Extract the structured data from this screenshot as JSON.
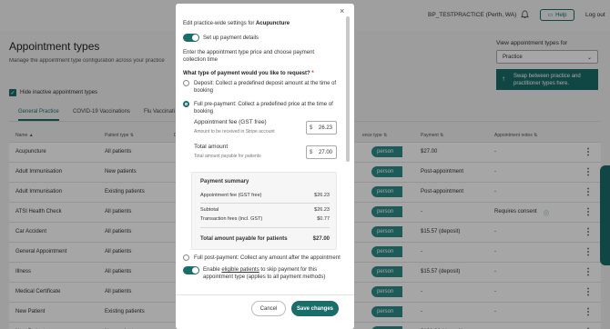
{
  "header": {
    "practice": "BP_TESTPRACTICE (Perth, WA)",
    "help_label": "Help",
    "logout_label": "Log out"
  },
  "page": {
    "title": "Appointment types",
    "subtitle": "Manage the appointment type configuration across your practice",
    "view_label": "View appointment types for",
    "view_value": "Practice",
    "swap_label": "Swap between practice and practitioner types here.",
    "hide_inactive_label": "Hide inactive appointment types"
  },
  "tabs": [
    "General Practice",
    "COVID-19 Vaccinations",
    "Flu Vaccinati"
  ],
  "table": {
    "headers": {
      "name": "Name",
      "patient_type": "Patient type",
      "d": "D",
      "attendance": "ence type",
      "payment": "Payment",
      "notes": "Appointment notes"
    },
    "rows": [
      {
        "name": "Acupuncture",
        "patient": "All patients",
        "att": "person",
        "payment": "$27.00",
        "notes": "-"
      },
      {
        "name": "Adult Immunisation",
        "patient": "New patients",
        "att": "person",
        "payment": "Post-appointment",
        "notes": "-"
      },
      {
        "name": "Adult Immunisation",
        "patient": "Existing patients",
        "att": "person",
        "payment": "Post-appointment",
        "notes": "-"
      },
      {
        "name": "ATSI Health Check",
        "patient": "All patients",
        "att": "person",
        "payment": "-",
        "notes": "Requires consent"
      },
      {
        "name": "Car Accident",
        "patient": "All patients",
        "att": "person",
        "payment": "$15.57 (deposit)",
        "notes": "-"
      },
      {
        "name": "General Appointment",
        "patient": "All patients",
        "att": "person",
        "payment": "-",
        "notes": "-"
      },
      {
        "name": "Illness",
        "patient": "All patients",
        "att": "person",
        "payment": "$15.57 (deposit)",
        "notes": "-"
      },
      {
        "name": "Medical Certificate",
        "patient": "All patients",
        "att": "person",
        "payment": "-",
        "notes": "-"
      },
      {
        "name": "New Patient",
        "patient": "Existing patients",
        "att": "person",
        "payment": "-",
        "notes": "-"
      },
      {
        "name": "New Patient",
        "patient": "New patients",
        "att": "person",
        "payment": "$101.06 (deposit)",
        "notes": "-"
      }
    ]
  },
  "side_tab_label": "Stripe Pay Guide",
  "modal": {
    "intro_prefix": "Edit practice-wide settings for ",
    "intro_name": "Acupuncture",
    "setup_label": "Set up payment details",
    "instructions": "Enter the appointment type price and choose payment collection time",
    "question": "What type of payment would you like to request?",
    "required_mark": "*",
    "option_deposit": "Deposit: Collect a predefined deposit amount at the time of booking",
    "option_full": "Full pre-payment: Collect a predefined price at the time of booking",
    "fee_label": "Appointment fee (GST free)",
    "fee_help": "Amount to be received in Stripe account",
    "fee_value": "26.23",
    "total_label": "Total amount",
    "total_help": "Total amount payable for patients",
    "total_value": "27.00",
    "currency": "$",
    "summary": {
      "title": "Payment summary",
      "fee_label": "Appointment fee (GST free)",
      "fee_value": "$26.23",
      "subtotal_label": "Subtotal",
      "subtotal_value": "$26.23",
      "txn_label": "Transaction fees (incl. GST)",
      "txn_value": "$0.77",
      "total_label": "Total amount payable for patients",
      "total_value": "$27.00"
    },
    "option_post": "Full post-payment: Collect any amount after the appointment",
    "eligible_prefix": "Enable ",
    "eligible_link": "eligible patients",
    "eligible_suffix": " to skip payment for this appointment type (applies to all payment methods)",
    "cancel_label": "Cancel",
    "save_label": "Save changes"
  },
  "colors": {
    "brand": "#1a6e6a",
    "pill": "#2b8c88"
  }
}
